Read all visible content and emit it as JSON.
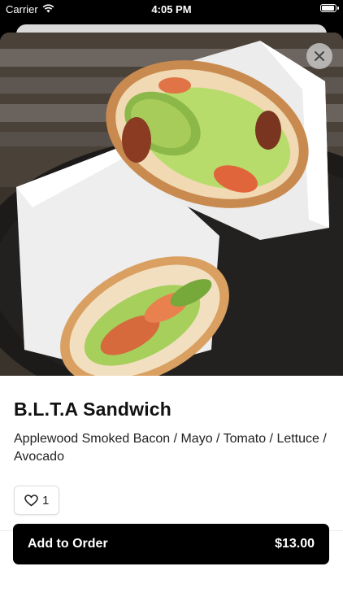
{
  "status_bar": {
    "carrier": "Carrier",
    "time": "4:05 PM"
  },
  "item": {
    "title": "B.L.T.A Sandwich",
    "description": "Applewood Smoked Bacon / Mayo / Tomato / Lettuce / Avocado",
    "like_count": "1"
  },
  "footer": {
    "add_label": "Add to Order",
    "price": "$13.00"
  },
  "icons": {
    "close": "close-icon",
    "like": "heart-icon",
    "wifi": "wifi-icon",
    "battery": "battery-icon"
  },
  "colors": {
    "primary_button": "#000000",
    "background": "#ffffff"
  }
}
